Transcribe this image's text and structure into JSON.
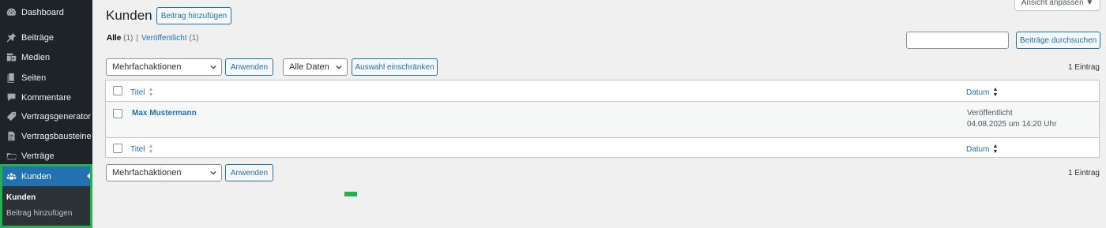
{
  "sidebar": {
    "items": [
      {
        "label": "Dashboard",
        "icon": "dashboard-icon"
      },
      {
        "label": "Beiträge",
        "icon": "pin-icon"
      },
      {
        "label": "Medien",
        "icon": "media-icon"
      },
      {
        "label": "Seiten",
        "icon": "pages-icon"
      },
      {
        "label": "Kommentare",
        "icon": "comment-icon"
      },
      {
        "label": "Vertragsgenerator",
        "icon": "tag-icon"
      },
      {
        "label": "Vertragsbausteine",
        "icon": "document-icon"
      },
      {
        "label": "Verträge",
        "icon": "folder-icon"
      },
      {
        "label": "Kunden",
        "icon": "groups-icon"
      }
    ],
    "submenu": [
      {
        "label": "Kunden"
      },
      {
        "label": "Beitrag hinzufügen"
      }
    ]
  },
  "header": {
    "title": "Kunden",
    "add_new_label": "Beitrag hinzufügen",
    "screen_options_label": "Ansicht anpassen ▼"
  },
  "filters": {
    "all_label": "Alle",
    "all_count": "(1)",
    "separator": "|",
    "published_label": "Veröffentlicht",
    "published_count": "(1)"
  },
  "search": {
    "value": "",
    "button_label": "Beiträge durchsuchen"
  },
  "top_nav": {
    "bulk_action": "Mehrfachaktionen",
    "apply_label": "Anwenden",
    "date_filter": "Alle Daten",
    "filter_label": "Auswahl einschränken",
    "items_count": "1 Eintrag"
  },
  "table": {
    "columns": {
      "title": "Titel",
      "date": "Datum"
    },
    "rows": [
      {
        "title": "Max Mustermann",
        "status": "Veröffentlicht",
        "date": "04.08.2025 um 14:20 Uhr"
      }
    ]
  },
  "bottom_nav": {
    "bulk_action": "Mehrfachaktionen",
    "apply_label": "Anwenden",
    "items_count": "1 Eintrag"
  },
  "colors": {
    "accent": "#2271b1",
    "sidebar_bg": "#1d2327",
    "highlight": "#22b14c"
  }
}
